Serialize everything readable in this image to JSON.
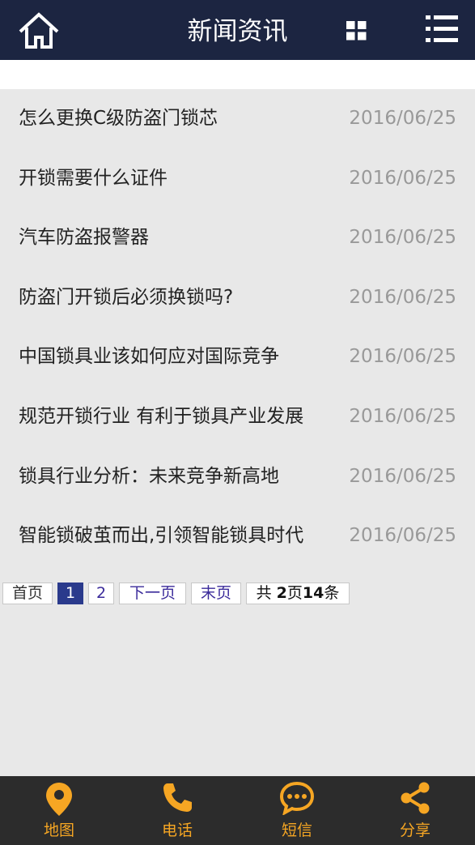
{
  "header": {
    "title": "新闻资讯",
    "icons": [
      "home-icon",
      "grid-icon",
      "menu-icon"
    ]
  },
  "news": [
    {
      "title": "怎么更换C级防盗门锁芯",
      "date": "2016/06/25"
    },
    {
      "title": "开锁需要什么证件",
      "date": "2016/06/25"
    },
    {
      "title": "汽车防盗报警器",
      "date": "2016/06/25"
    },
    {
      "title": "防盗门开锁后必须换锁吗?",
      "date": "2016/06/25"
    },
    {
      "title": "中国锁具业该如何应对国际竞争",
      "date": "2016/06/25"
    },
    {
      "title": "规范开锁行业 有利于锁具产业发展",
      "date": "2016/06/25"
    },
    {
      "title": "锁具行业分析：未来竞争新高地",
      "date": "2016/06/25"
    },
    {
      "title": "智能锁破茧而出,引领智能锁具时代",
      "date": "2016/06/25"
    }
  ],
  "pager": {
    "first": "首页",
    "page1": "1",
    "page2": "2",
    "next": "下一页",
    "last": "末页",
    "info_prefix": "共 ",
    "total_pages": "2",
    "info_mid": "页",
    "total_items": "14",
    "info_suffix": "条"
  },
  "bottom_nav": {
    "map": "地图",
    "phone": "电话",
    "sms": "短信",
    "share": "分享"
  },
  "colors": {
    "header_bg": "#1c2541",
    "accent": "#f6a623",
    "current_page": "#2a3a8c",
    "bottom_bg": "#2c2c2c"
  }
}
